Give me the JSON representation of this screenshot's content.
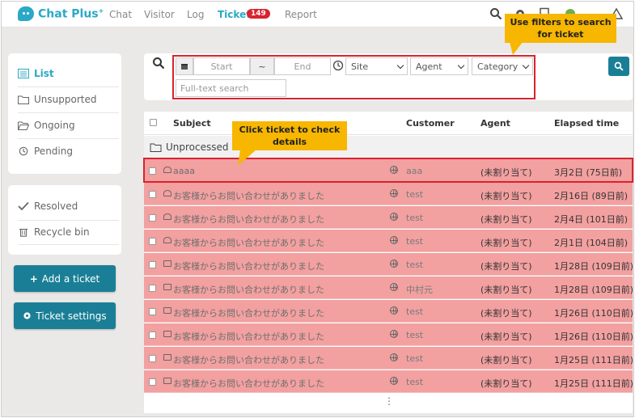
{
  "app": {
    "logo_text": "Chat Plus",
    "logo_mark": "+"
  },
  "nav": {
    "items": [
      {
        "label": "Chat"
      },
      {
        "label": "Visitor"
      },
      {
        "label": "Log"
      },
      {
        "label": "Ticket",
        "active": true,
        "badge": "149"
      },
      {
        "label": "Report"
      }
    ],
    "icons": [
      "search-icon",
      "gear-icon",
      "document-icon",
      "agent-status-icon",
      "warning-icon"
    ]
  },
  "sidebar": {
    "items": [
      {
        "label": "List",
        "icon": "list-icon",
        "active": true
      },
      {
        "label": "Unsupported",
        "icon": "folder-icon"
      },
      {
        "label": "Ongoing",
        "icon": "folder-open-icon"
      },
      {
        "label": "Pending",
        "icon": "clock-icon"
      }
    ],
    "items2": [
      {
        "label": "Resolved",
        "icon": "check-icon"
      },
      {
        "label": "Recycle bin",
        "icon": "trash-icon"
      }
    ],
    "add_ticket_label": "Add a ticket",
    "ticket_settings_label": "Ticket settings"
  },
  "filters": {
    "start_placeholder": "Start",
    "range_symbol": "~",
    "end_placeholder": "End",
    "site_label": "Site",
    "agent_label": "Agent",
    "category_label": "Category",
    "fulltext_placeholder": "Full-text search"
  },
  "callouts": {
    "filters": "Use filters to search for ticket",
    "ticket": "Click ticket to check details"
  },
  "table": {
    "headers": {
      "subject": "Subject",
      "customer": "Customer",
      "agent": "Agent",
      "elapsed": "Elapsed time"
    },
    "group_label": "Unprocessed",
    "rows": [
      {
        "subject": "aaaa",
        "customer": "aaa",
        "agent": "(未割り当て)",
        "elapsed": "3月2日 (75日前)",
        "mail": "open"
      },
      {
        "subject": "お客様からお問い合わせがありました",
        "customer": "test",
        "agent": "(未割り当て)",
        "elapsed": "2月16日 (89日前)",
        "mail": "open"
      },
      {
        "subject": "お客様からお問い合わせがありました",
        "customer": "test",
        "agent": "(未割り当て)",
        "elapsed": "2月4日 (101日前)",
        "mail": "open"
      },
      {
        "subject": "お客様からお問い合わせがありました",
        "customer": "test",
        "agent": "(未割り当て)",
        "elapsed": "2月1日 (104日前)",
        "mail": "open"
      },
      {
        "subject": "お客様からお問い合わせがありました",
        "customer": "test",
        "agent": "(未割り当て)",
        "elapsed": "1月28日 (109日前)",
        "mail": "closed"
      },
      {
        "subject": "お客様からお問い合わせがありました",
        "customer": "中村元",
        "agent": "(未割り当て)",
        "elapsed": "1月28日 (109日前)",
        "mail": "closed"
      },
      {
        "subject": "お客様からお問い合わせがありました",
        "customer": "test",
        "agent": "(未割り当て)",
        "elapsed": "1月26日 (110日前)",
        "mail": "closed"
      },
      {
        "subject": "お客様からお問い合わせがありました",
        "customer": "test",
        "agent": "(未割り当て)",
        "elapsed": "1月26日 (110日前)",
        "mail": "closed"
      },
      {
        "subject": "お客様からお問い合わせがありました",
        "customer": "test",
        "agent": "(未割り当て)",
        "elapsed": "1月25日 (111日前)",
        "mail": "closed"
      },
      {
        "subject": "お客様からお問い合わせがありました",
        "customer": "test",
        "agent": "(未割り当て)",
        "elapsed": "1月25日 (111日前)",
        "mail": "closed"
      }
    ],
    "more_indicator": "⋮"
  },
  "colors": {
    "accent": "#2aa8c7",
    "button": "#1a7f96",
    "row_highlight": "#f3a0a0",
    "callout": "#f7b600",
    "red_box": "#d9232f"
  }
}
